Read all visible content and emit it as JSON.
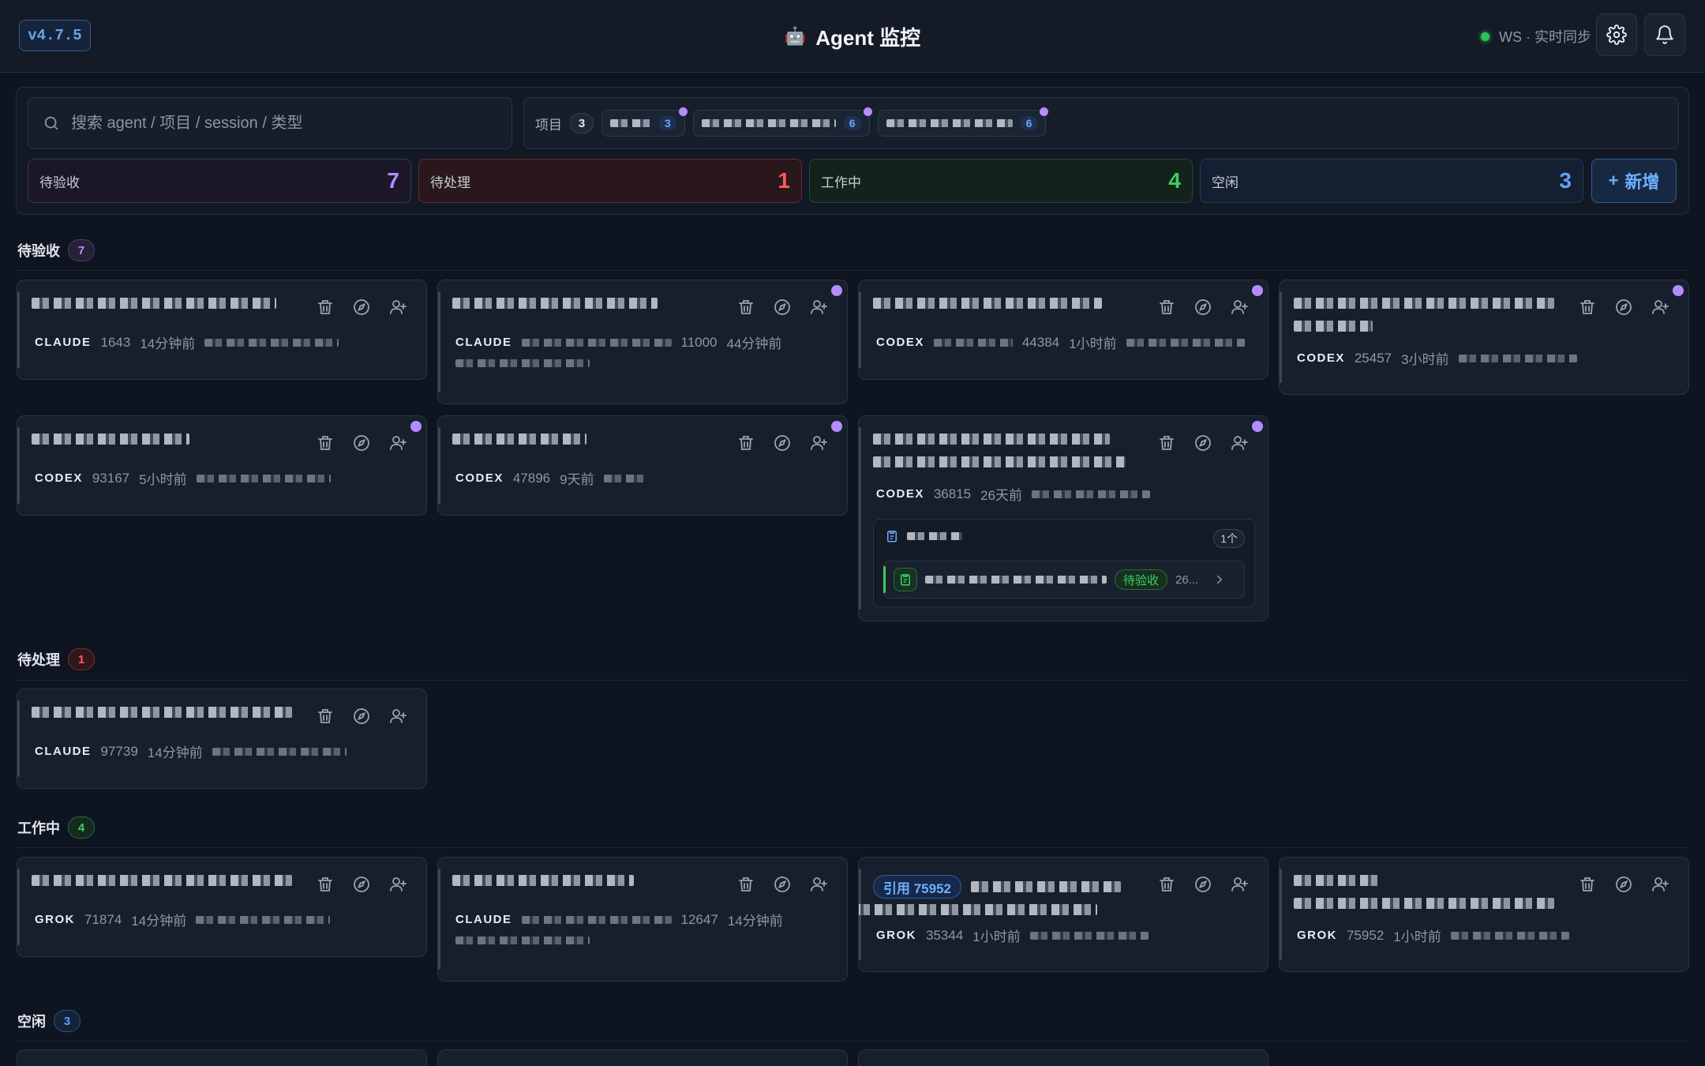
{
  "header": {
    "version": "v4.7.5",
    "title": "Agent 监控",
    "ws_status": "WS · 实时同步",
    "colors": {
      "accent": "#68a4e8",
      "ws_ok": "#2fbf5b"
    }
  },
  "filters": {
    "search_placeholder": "搜索 agent / 项目 / session / 类型",
    "projects_label": "项目",
    "projects_count": "3",
    "project_chips": [
      {
        "count": "3"
      },
      {
        "count": "6"
      },
      {
        "count": "6"
      }
    ]
  },
  "stats": {
    "accept": {
      "label": "待验收",
      "value": "7"
    },
    "pending": {
      "label": "待处理",
      "value": "1"
    },
    "working": {
      "label": "工作中",
      "value": "4"
    },
    "idle": {
      "label": "空闲",
      "value": "3"
    },
    "add_label": "新增"
  },
  "sections": {
    "accept": {
      "label": "待验收",
      "count": "7"
    },
    "pending": {
      "label": "待处理",
      "count": "1"
    },
    "working": {
      "label": "工作中",
      "count": "4"
    },
    "idle": {
      "label": "空闲",
      "count": "3"
    }
  },
  "cards": {
    "a1": {
      "type": "CLAUDE",
      "id": "1643",
      "time": "14分钟前"
    },
    "a2": {
      "type": "CLAUDE",
      "id": "11000",
      "time": "44分钟前"
    },
    "a3": {
      "type": "CODEX",
      "id": "44384",
      "time": "1小时前"
    },
    "a4": {
      "type": "CODEX",
      "id": "25457",
      "time": "3小时前"
    },
    "a5": {
      "type": "CODEX",
      "id": "93167",
      "time": "5小时前"
    },
    "a6": {
      "type": "CODEX",
      "id": "47896",
      "time": "9天前"
    },
    "a7": {
      "type": "CODEX",
      "id": "36815",
      "time": "26天前",
      "task_count": "1个",
      "task_status": "待验收",
      "task_more": "26..."
    },
    "p1": {
      "type": "CLAUDE",
      "id": "97739",
      "time": "14分钟前"
    },
    "w1": {
      "type": "GROK",
      "id": "71874",
      "time": "14分钟前"
    },
    "w2": {
      "type": "CLAUDE",
      "id": "12647",
      "time": "14分钟前"
    },
    "w3": {
      "type": "GROK",
      "id": "35344",
      "time": "1小时前",
      "ref": "引用 75952"
    },
    "w4": {
      "type": "GROK",
      "id": "75952",
      "time": "1小时前"
    }
  }
}
